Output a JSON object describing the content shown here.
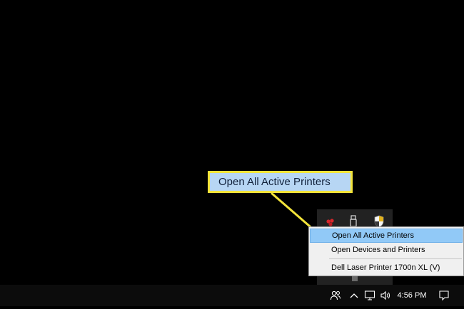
{
  "callout": {
    "text": "Open All Active Printers",
    "fill_color": "#b7d6f4",
    "border_color": "#f3e43a"
  },
  "context_menu": {
    "items": [
      {
        "label": "Open All Active Printers",
        "highlighted": true
      },
      {
        "label": "Open Devices and Printers",
        "highlighted": false
      },
      {
        "label": "Dell Laser Printer 1700n XL (V)",
        "highlighted": false
      }
    ],
    "highlight_color": "#91c9f7"
  },
  "tray_overflow": {
    "icons": [
      "printer-status-icon",
      "usb-drive-icon",
      "security-shield-icon"
    ]
  },
  "taskbar": {
    "icons": [
      "people-icon",
      "chevron-up-icon",
      "network-icon",
      "volume-icon",
      "action-center-icon"
    ],
    "clock": "4:56 PM"
  }
}
